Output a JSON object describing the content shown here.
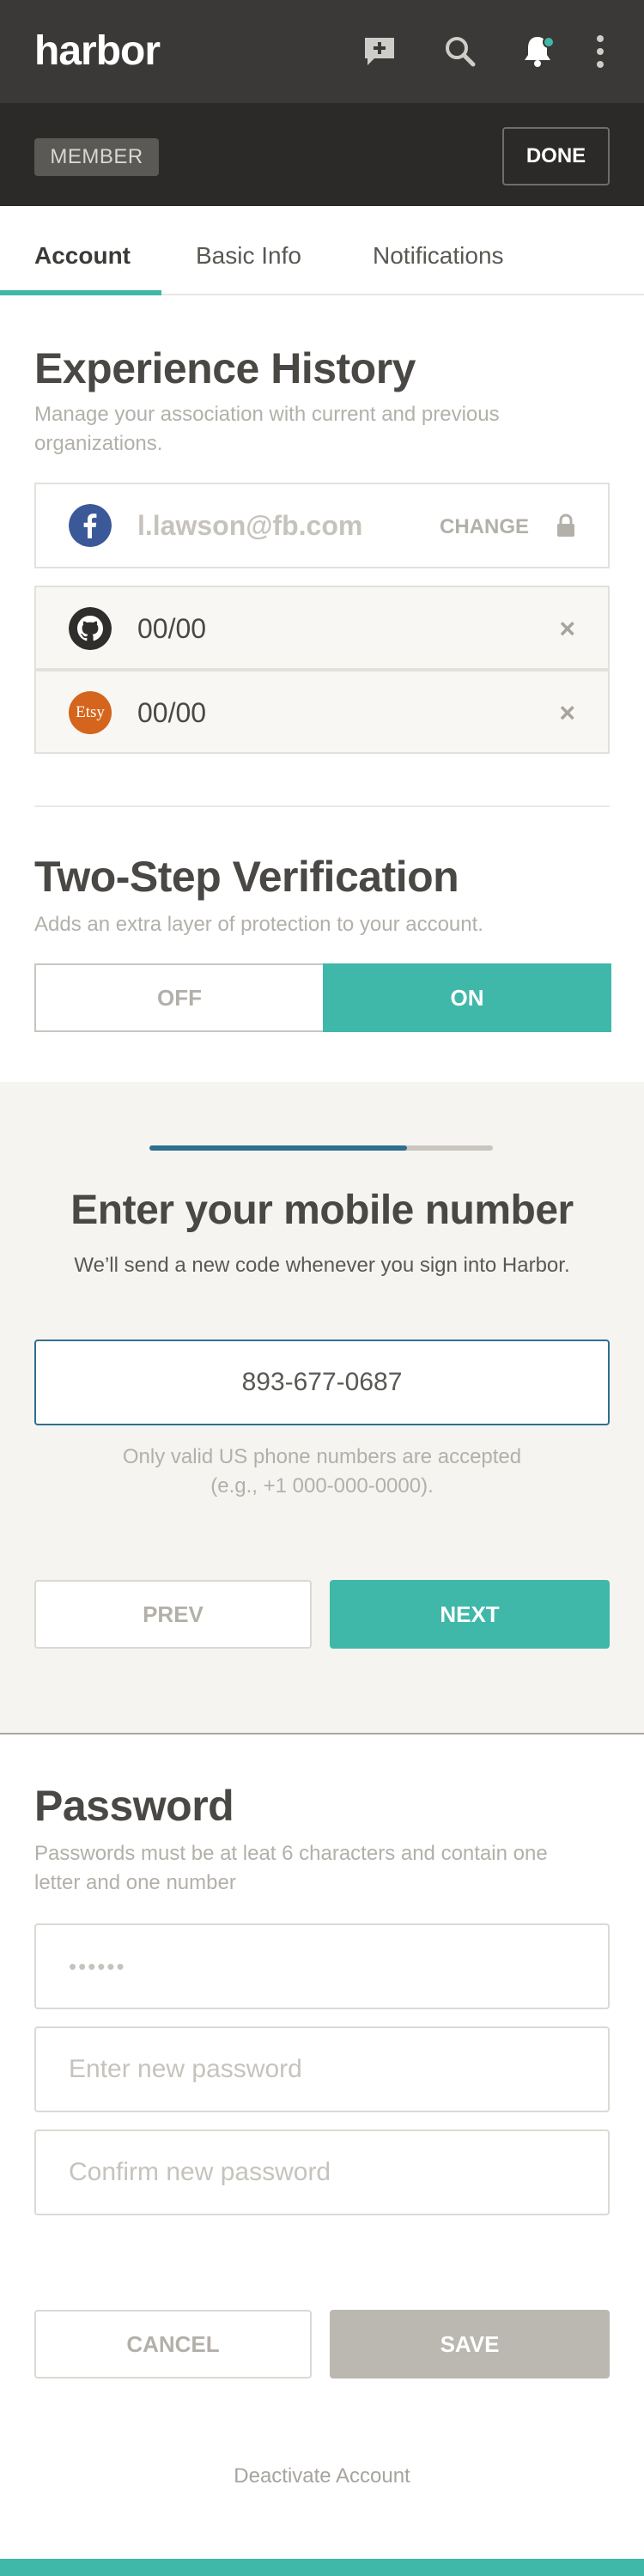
{
  "header": {
    "logo": "harbor",
    "icons": [
      "new-message-icon",
      "search-icon",
      "bell-icon",
      "more-vertical-icon"
    ],
    "member_badge": "MEMBER",
    "done_label": "DONE"
  },
  "tabs": [
    {
      "label": "Account",
      "active": true
    },
    {
      "label": "Basic Info",
      "active": false
    },
    {
      "label": "Notifications",
      "active": false
    }
  ],
  "experience": {
    "title": "Experience History",
    "description": "Manage your association with current and previous organizations.",
    "rows": [
      {
        "service": "facebook",
        "icon": "facebook-icon",
        "value": "l.lawson@fb.com",
        "action": "CHANGE",
        "locked": true
      },
      {
        "service": "github",
        "icon": "github-icon",
        "value": "00/00",
        "action": "×"
      },
      {
        "service": "etsy",
        "icon": "etsy-icon",
        "icon_text": "Etsy",
        "value": "00/00",
        "action": "×"
      }
    ]
  },
  "two_step": {
    "title": "Two-Step Verification",
    "description": "Adds an extra layer of protection to your account.",
    "off_label": "OFF",
    "on_label": "ON",
    "state": "on"
  },
  "mobile_step": {
    "progress": 0.75,
    "title": "Enter your mobile number",
    "subtitle": "We’ll send a new code whenever you sign into Harbor.",
    "phone_value": "893-677-0687",
    "hint_line1": "Only valid US phone numbers are accepted",
    "hint_line2": "(e.g., +1 000-000-0000).",
    "prev_label": "PREV",
    "next_label": "NEXT"
  },
  "password": {
    "title": "Password",
    "description": "Passwords must be at leat 6 characters and contain one letter and one number",
    "current_value": "••••••",
    "new_placeholder": "Enter new password",
    "confirm_placeholder": "Confirm new password",
    "cancel_label": "CANCEL",
    "save_label": "SAVE"
  },
  "footer": {
    "deactivate_label": "Deactivate Account"
  },
  "colors": {
    "accent": "#3fb8a9",
    "dark_header": "#3a3937",
    "subheader": "#2b2a28",
    "progress_fill": "#2f6f8f",
    "facebook": "#3b5998",
    "etsy": "#d5641c"
  }
}
